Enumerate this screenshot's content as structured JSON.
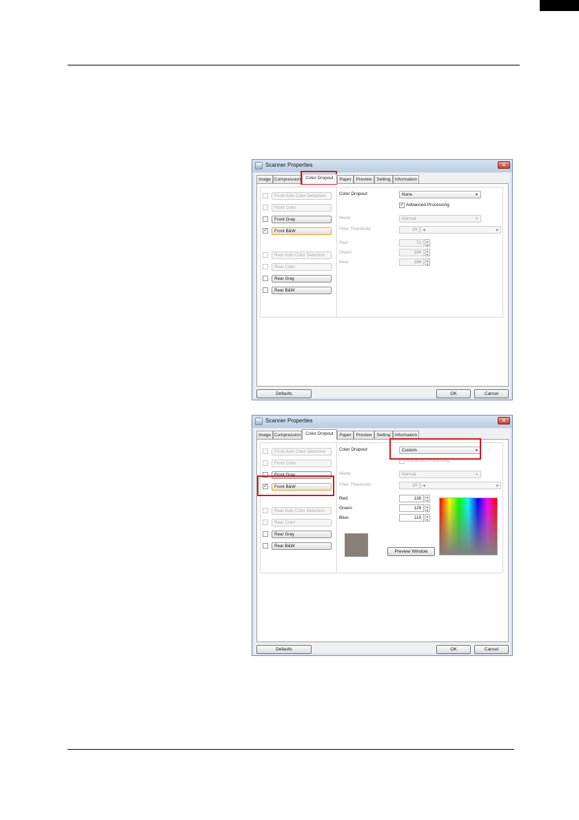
{
  "page": {
    "colors": {
      "rule": "#000000",
      "highlight": "#d8131b",
      "selected_outline": "#f0a020"
    }
  },
  "dialog1": {
    "title": "Scanner Properties",
    "tabs": [
      "Image",
      "Compression",
      "Color Dropout",
      "Paper",
      "Preview",
      "Setting",
      "Information"
    ],
    "active_tab": "Color Dropout",
    "highlighted_element": "tab-color-dropout",
    "image_list": [
      {
        "label": "Front Auto Color Detection",
        "checked": false,
        "enabled": false
      },
      {
        "label": "Front Color",
        "checked": false,
        "enabled": false
      },
      {
        "label": "Front Gray",
        "checked": false,
        "enabled": true
      },
      {
        "label": "Front B&W",
        "checked": true,
        "enabled": true
      },
      {
        "label": "Rear Auto Color Detection",
        "checked": false,
        "enabled": false
      },
      {
        "label": "Rear Color",
        "checked": false,
        "enabled": false
      },
      {
        "label": "Rear Gray",
        "checked": false,
        "enabled": true
      },
      {
        "label": "Rear B&W",
        "checked": false,
        "enabled": true
      }
    ],
    "color_dropout_label": "Color Dropout:",
    "color_dropout_value": "None",
    "advanced_processing_label": "Advanced Processing",
    "advanced_processing_checked": true,
    "mode_label": "Mode:",
    "mode_value": "Normal",
    "filter_threshold_label": "Filter Threshold:",
    "filter_threshold_value": "10",
    "red_label": "Red:",
    "red_value": "71",
    "green_label": "Green:",
    "green_value": "184",
    "blue_label": "Blue:",
    "blue_value": "184",
    "defaults_label": "Defaults",
    "ok_label": "OK",
    "cancel_label": "Cancel"
  },
  "dialog2": {
    "title": "Scanner Properties",
    "tabs": [
      "Image",
      "Compression",
      "Color Dropout",
      "Paper",
      "Preview",
      "Setting",
      "Information"
    ],
    "active_tab": "Color Dropout",
    "highlighted_elements": [
      "color-dropout-select",
      "image-item-front-bw"
    ],
    "image_list": [
      {
        "label": "Front Auto Color Detection",
        "checked": false,
        "enabled": false
      },
      {
        "label": "Front Color",
        "checked": false,
        "enabled": false
      },
      {
        "label": "Front Gray",
        "checked": false,
        "enabled": true
      },
      {
        "label": "Front B&W",
        "checked": true,
        "enabled": true
      },
      {
        "label": "Rear Auto Color Detection",
        "checked": false,
        "enabled": false
      },
      {
        "label": "Rear Color",
        "checked": false,
        "enabled": false
      },
      {
        "label": "Rear Gray",
        "checked": false,
        "enabled": true
      },
      {
        "label": "Rear B&W",
        "checked": false,
        "enabled": true
      }
    ],
    "color_dropout_label": "Color Dropout:",
    "color_dropout_value": "Custom",
    "advanced_processing_label": "Advanced Processing",
    "mode_label": "Mode:",
    "mode_value": "Normal",
    "filter_threshold_label": "Filter Threshold:",
    "filter_threshold_value": "10",
    "red_label": "Red:",
    "red_value": "136",
    "green_label": "Green:",
    "green_value": "129",
    "blue_label": "Blue:",
    "blue_value": "119",
    "swatch_color": "#887f77",
    "preview_window_label": "Preview Window",
    "defaults_label": "Defaults",
    "ok_label": "OK",
    "cancel_label": "Cancel"
  }
}
